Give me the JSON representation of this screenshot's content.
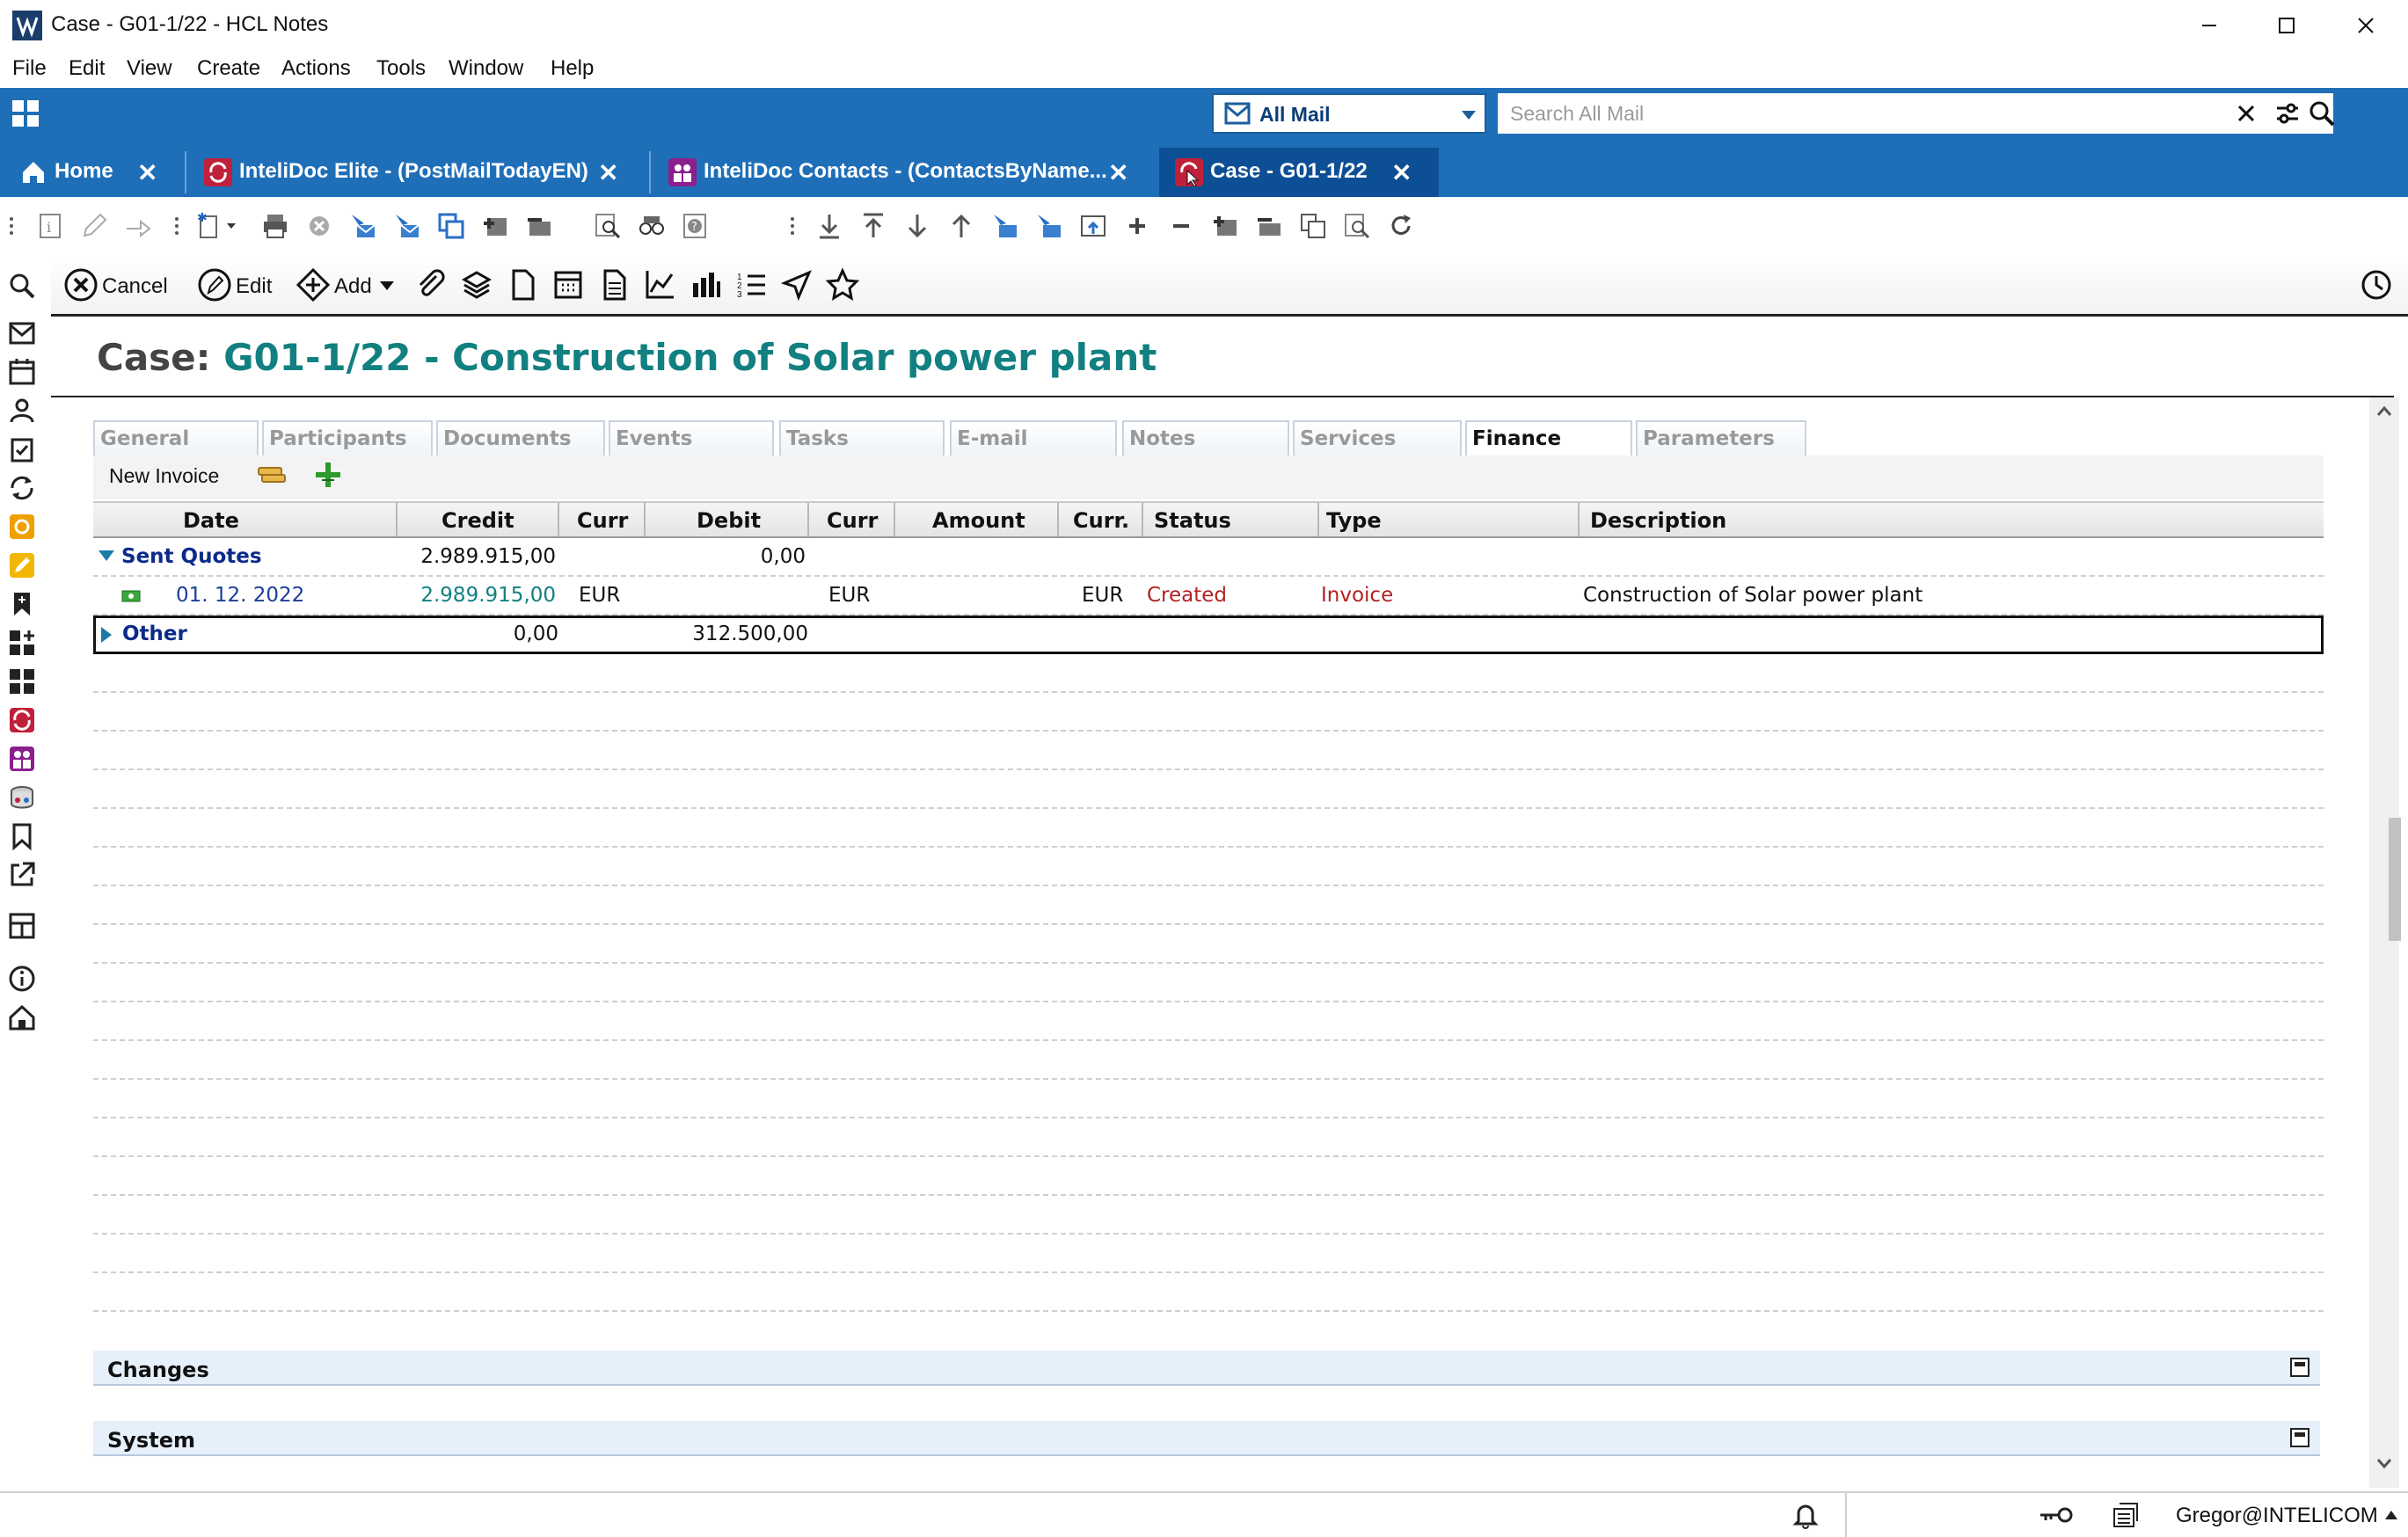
{
  "window": {
    "title": "Case - G01-1/22 - HCL Notes"
  },
  "menu": [
    "File",
    "Edit",
    "View",
    "Create",
    "Actions",
    "Tools",
    "Window",
    "Help"
  ],
  "header": {
    "scope_label": "All Mail",
    "search_placeholder": "Search All Mail"
  },
  "tabs": [
    {
      "label": "Home"
    },
    {
      "label": "InteliDoc Elite - (PostMailTodayEN)"
    },
    {
      "label": "InteliDoc Contacts - (ContactsByName..."
    },
    {
      "label": "Case - G01-1/22"
    }
  ],
  "actions": {
    "cancel": "Cancel",
    "edit": "Edit",
    "add": "Add"
  },
  "document": {
    "title_prefix": "Case:",
    "title_value": "G01-1/22 - Construction of Solar power plant"
  },
  "form_tabs": [
    "General",
    "Participants",
    "Documents",
    "Events",
    "Tasks",
    "E-mail",
    "Notes",
    "Services",
    "Finance",
    "Parameters"
  ],
  "finance": {
    "new_invoice_label": "New Invoice",
    "columns": [
      "Date",
      "Credit",
      "Curr",
      "Debit",
      "Curr",
      "Amount",
      "Curr.",
      "Status",
      "Type",
      "Description"
    ],
    "categories": [
      {
        "name": "Sent Quotes",
        "credit": "2.989.915,00",
        "debit": "0,00",
        "expanded": true
      },
      {
        "name": "Other",
        "credit": "0,00",
        "debit": "312.500,00",
        "expanded": false
      }
    ],
    "rows": [
      {
        "date": "01. 12. 2022",
        "credit": "2.989.915,00",
        "curr": "EUR",
        "curr2": "EUR",
        "curr3": "EUR",
        "status": "Created",
        "type": "Invoice",
        "description": "Construction of Solar power plant"
      }
    ]
  },
  "sections": {
    "changes": "Changes",
    "system": "System"
  },
  "status": {
    "user": "Gregor@INTELICOM"
  },
  "colors": {
    "blue_header": "#1f6fb8",
    "active_tab": "#0d4f94",
    "teal": "#128080",
    "status_red": "#b22222"
  }
}
